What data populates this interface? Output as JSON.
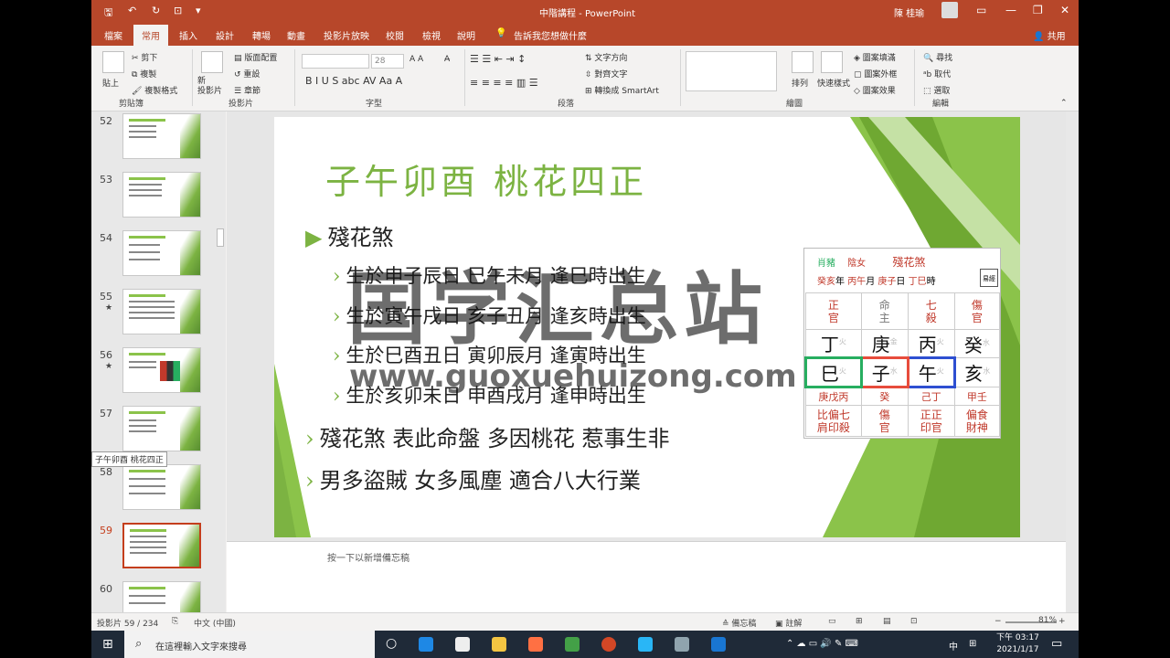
{
  "window": {
    "title": "中階講程",
    "app": "PowerPoint",
    "user": "陳 桂瑜",
    "controls": {
      "minimize": "—",
      "restore": "❐",
      "close": "✕",
      "ribbon_display": "▭"
    }
  },
  "quick_access": {
    "save": "🖫",
    "undo": "↶",
    "redo": "↻",
    "present": "⊡",
    "more": "▾"
  },
  "tabs": [
    {
      "label": "檔案"
    },
    {
      "label": "常用"
    },
    {
      "label": "插入"
    },
    {
      "label": "設計"
    },
    {
      "label": "轉場"
    },
    {
      "label": "動畫"
    },
    {
      "label": "投影片放映"
    },
    {
      "label": "校閱"
    },
    {
      "label": "檢視"
    },
    {
      "label": "說明"
    }
  ],
  "tell_me": "告訴我您想做什麼",
  "share": "共用",
  "ribbon": {
    "clipboard": {
      "paste": "貼上",
      "cut": "剪下",
      "copy": "複製",
      "format_painter": "複製格式",
      "group": "剪貼簿"
    },
    "slides": {
      "new_slide": "新\n投影片",
      "layout": "版面配置",
      "reset": "重設",
      "section": "章節",
      "group": "投影片"
    },
    "font": {
      "size": "28",
      "group": "字型"
    },
    "paragraph": {
      "text_direction": "文字方向",
      "align_text": "對齊文字",
      "smartart": "轉換成 SmartArt",
      "group": "段落"
    },
    "drawing": {
      "arrange": "排列",
      "quick_styles": "快速樣式",
      "shape_fill": "圖案填滿",
      "shape_outline": "圖案外框",
      "shape_effects": "圖案效果",
      "group": "繪圖"
    },
    "editing": {
      "find": "尋找",
      "replace": "取代",
      "select": "選取",
      "group": "編輯"
    }
  },
  "thumbnails": [
    {
      "num": "52",
      "star": ""
    },
    {
      "num": "53",
      "star": ""
    },
    {
      "num": "54",
      "star": ""
    },
    {
      "num": "55",
      "star": "★"
    },
    {
      "num": "56",
      "star": "★"
    },
    {
      "num": "57",
      "star": ""
    },
    {
      "num": "58",
      "star": ""
    },
    {
      "num": "59",
      "star": "",
      "selected": true
    },
    {
      "num": "60",
      "star": ""
    }
  ],
  "thumb_tooltip": "子午卯酉 桃花四正",
  "slide": {
    "title": "子午卯酉 桃花四正",
    "bullets": [
      {
        "level": 1,
        "text": "殘花煞"
      },
      {
        "level": 2,
        "text": "生於申子辰日  巳午未月  逢巳時出生"
      },
      {
        "level": 2,
        "text": "生於寅午戌日  亥子丑月  逢亥時出生"
      },
      {
        "level": 2,
        "text": "生於巳酉丑日  寅卯辰月  逢寅時出生"
      },
      {
        "level": 2,
        "text": "生於亥卯未日  申酉戌月  逢申時出生"
      },
      {
        "level": 1,
        "text": "殘花煞  表此命盤  多因桃花  惹事生非"
      },
      {
        "level": 1,
        "text": "男多盜賊  女多風塵  適合八大行業"
      }
    ]
  },
  "bazi": {
    "zodiac": "肖豬",
    "gender": "陰女",
    "sha": "殘花煞",
    "date_line": [
      {
        "v": "癸亥",
        "u": "年"
      },
      {
        "v": "丙午",
        "u": "月"
      },
      {
        "v": "庚子",
        "u": "日"
      },
      {
        "v": "丁巳",
        "u": "時"
      }
    ],
    "logo": "易經",
    "gods": [
      "正\n官",
      "命\n主",
      "七\n殺",
      "傷\n官"
    ],
    "stems": [
      "丁",
      "庚",
      "丙",
      "癸"
    ],
    "stem_el": [
      "火",
      "金",
      "火",
      "水"
    ],
    "branches": [
      "巳",
      "子",
      "午",
      "亥"
    ],
    "branch_el": [
      "火",
      "水",
      "火",
      "水"
    ],
    "hidden_stems": [
      "庚戊丙",
      "癸",
      "己丁",
      "甲壬"
    ],
    "hidden_gods": [
      "比偏七\n肩印殺",
      "傷\n官",
      "正正\n印官",
      "偏食\n財神"
    ]
  },
  "watermark": {
    "cn": "国学汇总站",
    "url": "www.guoxuehuizong.com"
  },
  "notes_placeholder": "按一下以新增備忘稿",
  "status": {
    "slide_counter": "投影片 59 / 234",
    "language": "中文 (中國)",
    "notes": "備忘稿",
    "comments": "註解",
    "zoom": "81%"
  },
  "taskbar": {
    "search_placeholder": "在這裡輸入文字來搜尋",
    "time": "下午 03:17",
    "date": "2021/1/17",
    "ime": "中"
  },
  "colors": {
    "accent": "#b7472a",
    "slide_green": "#7cb342",
    "box_green": "#27ae60",
    "box_red": "#e74c3c",
    "box_blue": "#2e4fd1"
  }
}
